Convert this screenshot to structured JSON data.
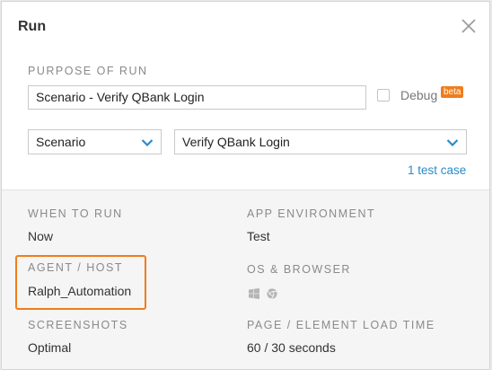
{
  "dialog": {
    "title": "Run"
  },
  "purpose": {
    "label": "PURPOSE OF RUN",
    "value": "Scenario -  Verify QBank Login",
    "debug_label": "Debug",
    "beta_badge": "beta"
  },
  "selectors": {
    "type_value": "Scenario",
    "target_value": "Verify QBank Login"
  },
  "test_case_link": "1 test case",
  "settings": {
    "when_to_run": {
      "label": "WHEN TO RUN",
      "value": "Now"
    },
    "app_environment": {
      "label": "APP ENVIRONMENT",
      "value": "Test"
    },
    "agent_host": {
      "label": "AGENT / HOST",
      "value": "Ralph_Automation"
    },
    "os_browser": {
      "label": "OS & BROWSER",
      "icons": [
        "windows-icon",
        "chrome-icon"
      ]
    },
    "screenshots": {
      "label": "SCREENSHOTS",
      "value": "Optimal"
    },
    "load_time": {
      "label": "PAGE / ELEMENT LOAD TIME",
      "value": "60 / 30 seconds"
    }
  },
  "colors": {
    "accent_link": "#2a8bc9",
    "highlight": "#f07d1a",
    "beta": "#ef7d1e"
  }
}
